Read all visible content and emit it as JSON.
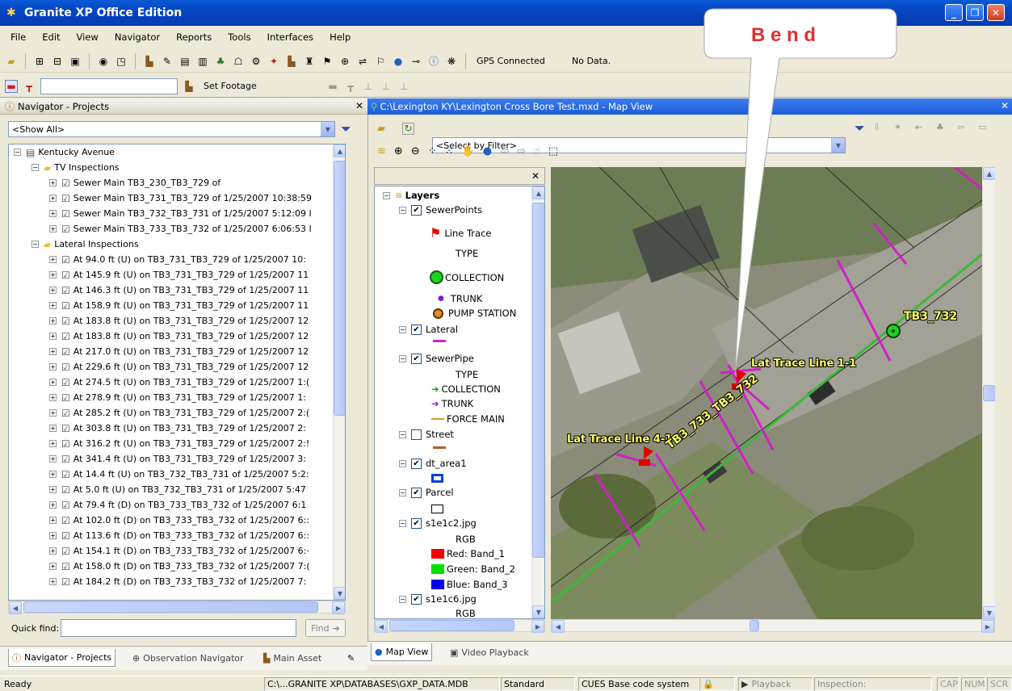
{
  "window": {
    "title": "Granite XP  Office Edition"
  },
  "menu": [
    "File",
    "Edit",
    "View",
    "Navigator",
    "Reports",
    "Tools",
    "Interfaces",
    "Help"
  ],
  "toolbar": {
    "gps_status": "GPS Connected",
    "data_status": "No Data.",
    "set_footage": "Set Footage"
  },
  "callout": {
    "text": "B e n d"
  },
  "navigator": {
    "header": "Navigator - Projects",
    "filter_value": "<Show All>",
    "tree": [
      {
        "indent": 0,
        "pm": "−",
        "icon": "project",
        "text": "Kentucky Avenue"
      },
      {
        "indent": 1,
        "pm": "−",
        "icon": "folder",
        "text": "TV Inspections"
      },
      {
        "indent": 2,
        "pm": "+",
        "icon": "check",
        "text": "Sewer Main TB3_230_TB3_729 of"
      },
      {
        "indent": 2,
        "pm": "+",
        "icon": "check",
        "text": "Sewer Main TB3_731_TB3_729 of 1/25/2007 10:38:59"
      },
      {
        "indent": 2,
        "pm": "+",
        "icon": "check",
        "text": "Sewer Main TB3_732_TB3_731 of 1/25/2007 5:12:09 I"
      },
      {
        "indent": 2,
        "pm": "+",
        "icon": "check",
        "text": "Sewer Main TB3_733_TB3_732 of 1/25/2007 6:06:53 I"
      },
      {
        "indent": 1,
        "pm": "−",
        "icon": "folder",
        "text": "Lateral Inspections"
      },
      {
        "indent": 2,
        "pm": "+",
        "icon": "check",
        "text": "At 94.0 ft (U) on TB3_731_TB3_729 of 1/25/2007 10:"
      },
      {
        "indent": 2,
        "pm": "+",
        "icon": "check",
        "text": "At 145.9 ft (U) on TB3_731_TB3_729 of 1/25/2007 11"
      },
      {
        "indent": 2,
        "pm": "+",
        "icon": "check",
        "text": "At 146.3 ft (U) on TB3_731_TB3_729 of 1/25/2007 11"
      },
      {
        "indent": 2,
        "pm": "+",
        "icon": "check",
        "text": "At 158.9 ft (U) on TB3_731_TB3_729 of 1/25/2007 11"
      },
      {
        "indent": 2,
        "pm": "+",
        "icon": "check",
        "text": "At 183.8 ft (U) on TB3_731_TB3_729 of 1/25/2007 12"
      },
      {
        "indent": 2,
        "pm": "+",
        "icon": "check",
        "text": "At 183.8 ft (U) on TB3_731_TB3_729 of 1/25/2007 12"
      },
      {
        "indent": 2,
        "pm": "+",
        "icon": "check",
        "text": "At 217.0 ft (U) on TB3_731_TB3_729 of 1/25/2007 12"
      },
      {
        "indent": 2,
        "pm": "+",
        "icon": "check",
        "text": "At 229.6 ft (U) on TB3_731_TB3_729 of 1/25/2007 12"
      },
      {
        "indent": 2,
        "pm": "+",
        "icon": "check",
        "text": "At 274.5 ft (U) on TB3_731_TB3_729 of 1/25/2007 1:("
      },
      {
        "indent": 2,
        "pm": "+",
        "icon": "check",
        "text": "At 278.9 ft (U) on TB3_731_TB3_729 of 1/25/2007 1:"
      },
      {
        "indent": 2,
        "pm": "+",
        "icon": "check",
        "text": "At 285.2 ft (U) on TB3_731_TB3_729 of 1/25/2007 2:("
      },
      {
        "indent": 2,
        "pm": "+",
        "icon": "check",
        "text": "At 303.8 ft (U) on TB3_731_TB3_729 of 1/25/2007 2:"
      },
      {
        "indent": 2,
        "pm": "+",
        "icon": "check",
        "text": "At 316.2 ft (U) on TB3_731_TB3_729 of 1/25/2007 2:!"
      },
      {
        "indent": 2,
        "pm": "+",
        "icon": "check",
        "text": "At 341.4 ft (U) on TB3_731_TB3_729 of 1/25/2007 3:"
      },
      {
        "indent": 2,
        "pm": "+",
        "icon": "check",
        "text": "At 14.4 ft (U) on TB3_732_TB3_731 of 1/25/2007 5:2:"
      },
      {
        "indent": 2,
        "pm": "+",
        "icon": "check",
        "text": "At 5.0 ft (U) on TB3_732_TB3_731 of 1/25/2007 5:47"
      },
      {
        "indent": 2,
        "pm": "+",
        "icon": "check",
        "text": "At 79.4 ft (D) on TB3_733_TB3_732 of 1/25/2007 6:1"
      },
      {
        "indent": 2,
        "pm": "+",
        "icon": "check",
        "text": "At 102.0 ft (D) on TB3_733_TB3_732 of 1/25/2007 6::"
      },
      {
        "indent": 2,
        "pm": "+",
        "icon": "check",
        "text": "At 113.6 ft (D) on TB3_733_TB3_732 of 1/25/2007 6::"
      },
      {
        "indent": 2,
        "pm": "+",
        "icon": "check",
        "text": "At 154.1 ft (D) on TB3_733_TB3_732 of 1/25/2007 6:·"
      },
      {
        "indent": 2,
        "pm": "+",
        "icon": "check",
        "text": "At 158.0 ft (D) on TB3_733_TB3_732 of 1/25/2007 7:("
      },
      {
        "indent": 2,
        "pm": "+",
        "icon": "check",
        "text": "At 184.2 ft (D) on TB3_733_TB3_732 of 1/25/2007 7:"
      }
    ],
    "quick_find_label": "Quick find:",
    "find_button": "Find",
    "tabs": [
      "Navigator - Projects",
      "Observation Navigator",
      "Main Asset"
    ]
  },
  "mapview": {
    "header": "C:\\Lexington KY\\Lexington Cross Bore Test.mxd - Map View",
    "filter_value": "<Select by Filter>",
    "tabs": [
      "Map View",
      "Video Playback"
    ],
    "labels": {
      "node": "TB3_732",
      "pipe": "TB3_733_TB3_732",
      "lat1": "Lat Trace Line 1-1",
      "lat4": "Lat Trace Line 4-1"
    }
  },
  "layers": {
    "root": "Layers",
    "sewer_points": "SewerPoints",
    "line_trace": "Line Trace",
    "type1": "TYPE",
    "collection1": "COLLECTION",
    "trunk1": "TRUNK",
    "pump_station": "PUMP STATION",
    "lateral": "Lateral",
    "sewer_pipe": "SewerPipe",
    "type2": "TYPE",
    "collection2": "COLLECTION",
    "trunk2": "TRUNK",
    "force_main": "FORCE MAIN",
    "street": "Street",
    "dt_area1": "dt_area1",
    "parcel": "Parcel",
    "img1": "s1e1c2.jpg",
    "rgb1": "RGB",
    "red": "Red:   Band_1",
    "green": "Green: Band_2",
    "blue": "Blue:  Band_3",
    "img2": "s1e1c6.jpg",
    "rgb2": "RGB"
  },
  "status": {
    "ready": "Ready",
    "path": "C:\\...GRANITE XP\\DATABASES\\GXP_DATA.MDB",
    "mode": "Standard",
    "code_system": "CUES Base code system",
    "playback": "Playback",
    "inspection": "Inspection:",
    "cap": "CAP",
    "num": "NUM",
    "scr": "SCR"
  },
  "colors": {
    "accent": "#0a5ad6",
    "map_label_fill": "#ffff66",
    "lateral_line": "#d020c8",
    "pipe_line": "#3cb83c"
  }
}
